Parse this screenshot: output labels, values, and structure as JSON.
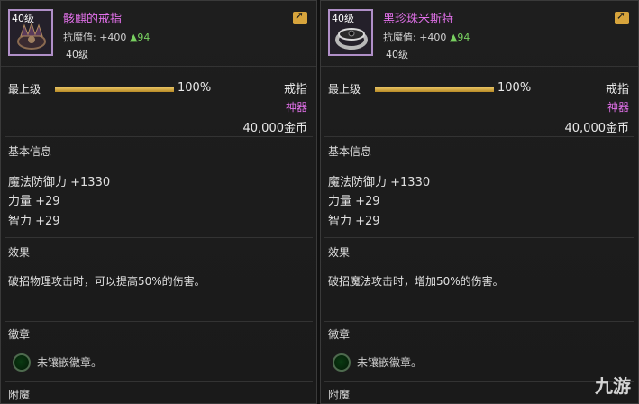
{
  "items": [
    {
      "level_badge": "40级",
      "name": "骸麒的戒指",
      "stat_label": "抗魔值:",
      "stat_value": "+400",
      "stat_up": "▲94",
      "level": "40级",
      "progress_label": "最上级",
      "progress": 1.0,
      "progress_text": "100%",
      "type": "戒指",
      "rarity": "神器",
      "price": "40,000金币",
      "basic_title": "基本信息",
      "attrs": [
        "魔法防御力 +1330",
        "力量 +29",
        "智力 +29"
      ],
      "effect_title": "效果",
      "effect": "破招物理攻击时，可以提高50%的伤害。",
      "emblem_title": "徽章",
      "emblem_text": "未镶嵌徽章。",
      "enchant_title": "附魔"
    },
    {
      "level_badge": "40级",
      "name": "黑珍珠米斯特",
      "stat_label": "抗魔值:",
      "stat_value": "+400",
      "stat_up": "▲94",
      "level": "40级",
      "progress_label": "最上级",
      "progress": 1.0,
      "progress_text": "100%",
      "type": "戒指",
      "rarity": "神器",
      "price": "40,000金币",
      "basic_title": "基本信息",
      "attrs": [
        "魔法防御力 +1330",
        "力量 +29",
        "智力 +29"
      ],
      "effect_title": "效果",
      "effect": "破招魔法攻击时，增加50%的伤害。",
      "emblem_title": "徽章",
      "emblem_text": "未镶嵌徽章。",
      "enchant_title": "附魔"
    }
  ],
  "watermark": "九游",
  "colors": {
    "name": "#e070e8",
    "rarity": "#e070e8",
    "stat_up": "#78d060",
    "bar": "#d9b04a"
  }
}
